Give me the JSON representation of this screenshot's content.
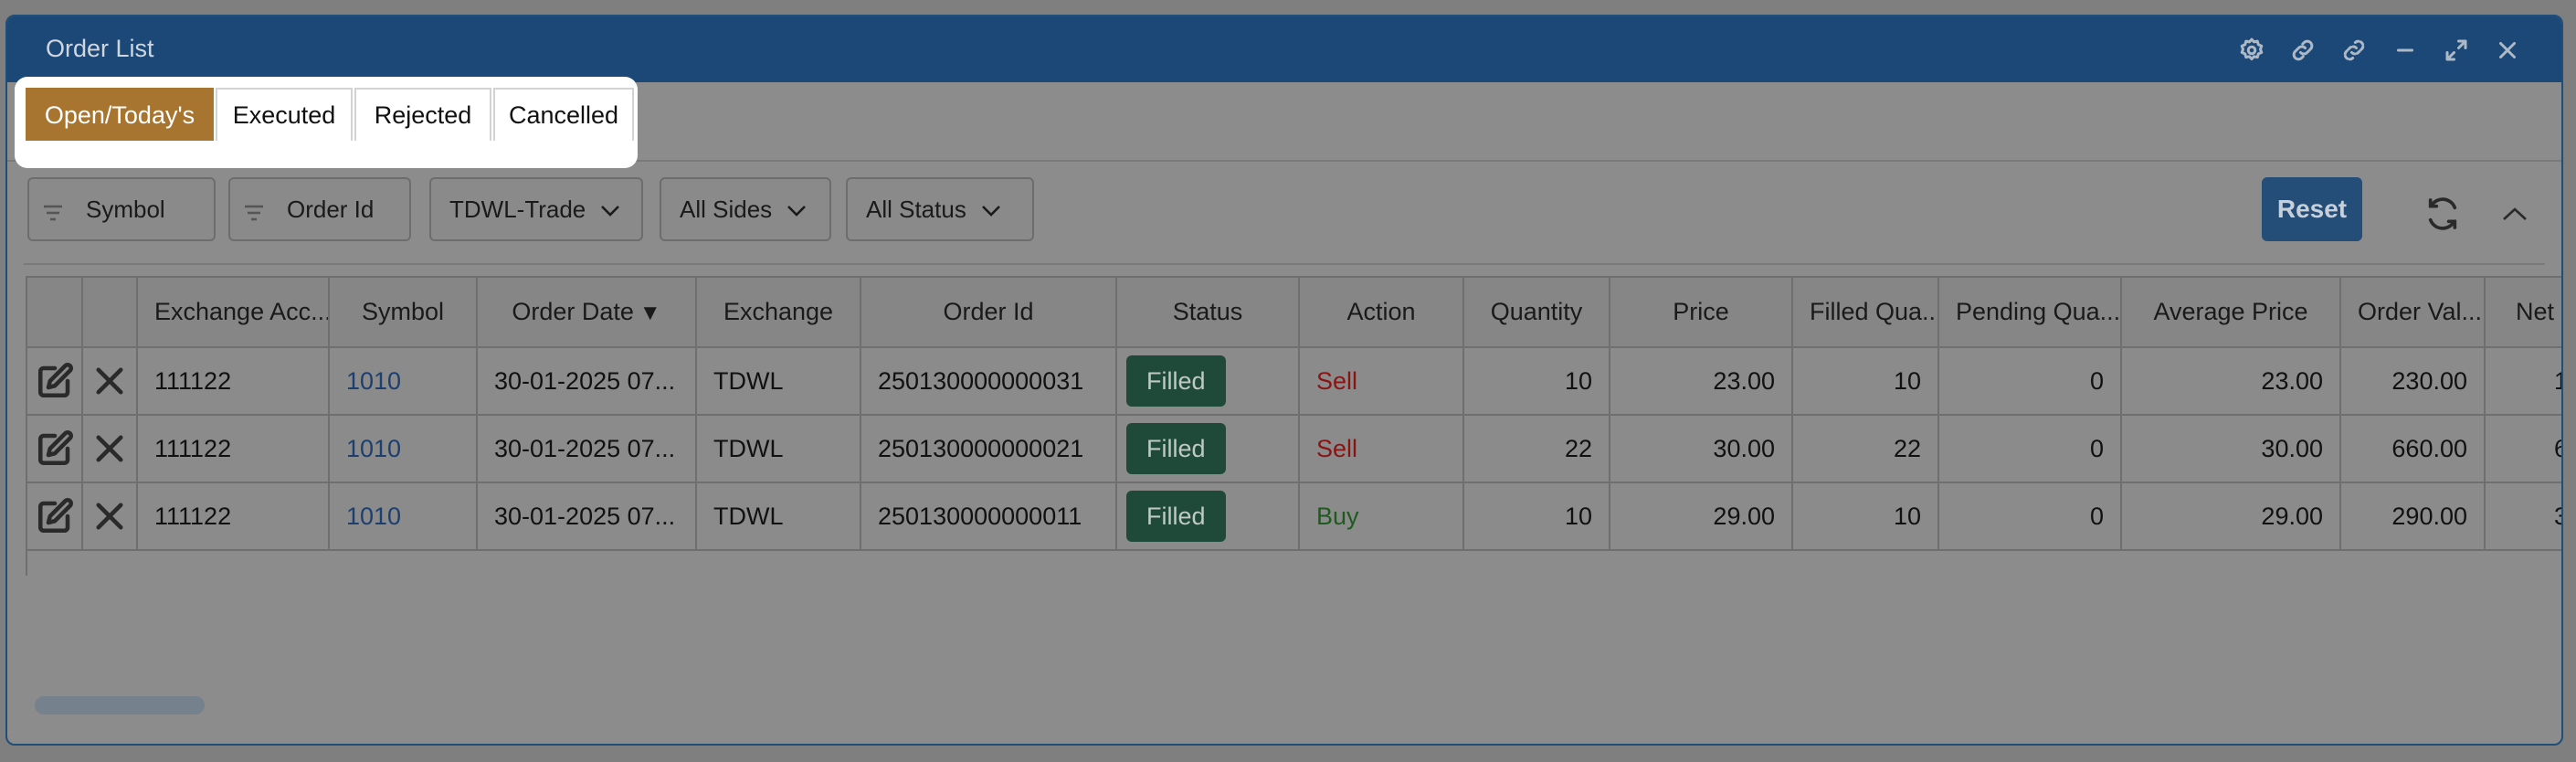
{
  "window": {
    "title": "Order List"
  },
  "tabs": [
    {
      "label": "Open/Today's",
      "active": true
    },
    {
      "label": "Executed",
      "active": false
    },
    {
      "label": "Rejected",
      "active": false
    },
    {
      "label": "Cancelled",
      "active": false
    }
  ],
  "filters": {
    "symbol_placeholder": "Symbol",
    "order_id_placeholder": "Order Id",
    "trade_select": "TDWL-Trade",
    "sides_select": "All Sides",
    "status_select": "All Status",
    "reset_label": "Reset"
  },
  "table": {
    "columns": [
      "",
      "",
      "Exchange Acc...",
      "Symbol",
      "Order Date",
      "Exchange",
      "Order Id",
      "Status",
      "Action",
      "Quantity",
      "Price",
      "Filled Qua...",
      "Pending Qua...",
      "Average Price",
      "Order Val...",
      "Net"
    ],
    "sort_indicator": "▼",
    "rows": [
      {
        "account": "111122",
        "symbol": "1010",
        "order_date": "30-01-2025 07...",
        "exchange": "TDWL",
        "order_id": "250130000000031",
        "status": "Filled",
        "action": "Sell",
        "quantity": "10",
        "price": "23.00",
        "filled_qty": "10",
        "pending_qty": "0",
        "avg_price": "23.00",
        "order_value": "230.00",
        "net": "1"
      },
      {
        "account": "111122",
        "symbol": "1010",
        "order_date": "30-01-2025 07...",
        "exchange": "TDWL",
        "order_id": "250130000000021",
        "status": "Filled",
        "action": "Sell",
        "quantity": "22",
        "price": "30.00",
        "filled_qty": "22",
        "pending_qty": "0",
        "avg_price": "30.00",
        "order_value": "660.00",
        "net": "6"
      },
      {
        "account": "111122",
        "symbol": "1010",
        "order_date": "30-01-2025 07...",
        "exchange": "TDWL",
        "order_id": "250130000000011",
        "status": "Filled",
        "action": "Buy",
        "quantity": "10",
        "price": "29.00",
        "filled_qty": "10",
        "pending_qty": "0",
        "avg_price": "29.00",
        "order_value": "290.00",
        "net": "3"
      }
    ]
  },
  "colors": {
    "titlebar": "#1c4878",
    "active_tab": "#a87530",
    "reset_button": "#244d78",
    "filled_badge": "#1f4a3a",
    "sell_text": "#8a1414",
    "buy_text": "#1f5a1f",
    "symbol_link": "#1d3f70"
  },
  "icons": [
    "settings-icon",
    "link-icon",
    "unlink-icon",
    "minimize-icon",
    "maximize-icon",
    "close-icon",
    "filter-icon",
    "chevron-down-icon",
    "refresh-icon",
    "chevron-up-icon",
    "edit-icon",
    "cancel-order-icon"
  ]
}
